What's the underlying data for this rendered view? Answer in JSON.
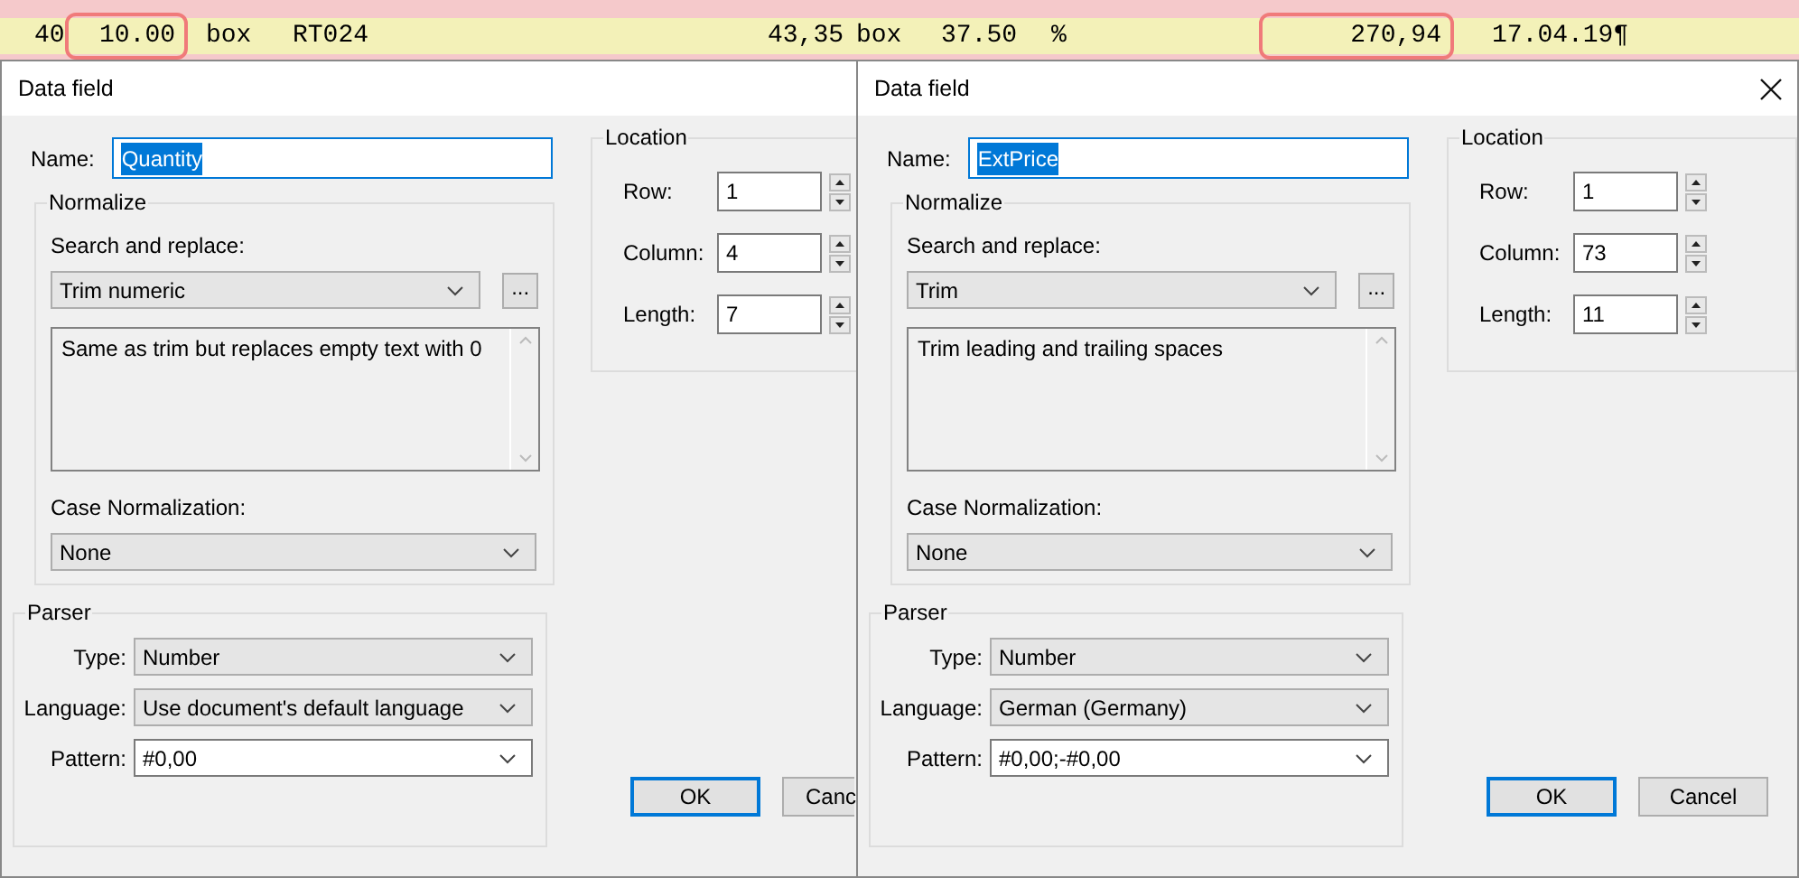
{
  "document_row": {
    "cells": [
      {
        "text": "40",
        "highlighted": false
      },
      {
        "text": "10.00",
        "highlighted": true
      },
      {
        "text": "box",
        "highlighted": false
      },
      {
        "text": "RT024",
        "highlighted": false
      },
      {
        "text": "43,35",
        "highlighted": false
      },
      {
        "text": "box",
        "highlighted": false
      },
      {
        "text": "37.50",
        "highlighted": false
      },
      {
        "text": "%",
        "highlighted": false
      },
      {
        "text": "270,94",
        "highlighted": true
      },
      {
        "text": "17.04.19¶",
        "highlighted": false
      }
    ]
  },
  "dialogs": [
    {
      "title": "Data field",
      "close_button": false,
      "name": {
        "label": "Name:",
        "value": "Quantity",
        "value_selected": true
      },
      "normalize": {
        "title": "Normalize",
        "search_label": "Search and replace:",
        "search_value": "Trim numeric",
        "more_button": "...",
        "description": "Same as trim but replaces empty text with 0",
        "case_label": "Case Normalization:",
        "case_value": "None"
      },
      "parser": {
        "title": "Parser",
        "fields": [
          {
            "kind": "combo",
            "label": "Type:",
            "value": "Number"
          },
          {
            "kind": "combo",
            "label": "Language:",
            "value": "Use document's default language"
          },
          {
            "kind": "editable",
            "label": "Pattern:",
            "value": "#0,00"
          }
        ]
      },
      "location": {
        "title": "Location",
        "fields": [
          {
            "label": "Row:",
            "value": "1"
          },
          {
            "label": "Column:",
            "value": "4"
          },
          {
            "label": "Length:",
            "value": "7"
          }
        ]
      },
      "buttons": [
        {
          "label": "OK",
          "default": true
        },
        {
          "label": "Canc",
          "default": false
        }
      ]
    },
    {
      "title": "Data field",
      "close_button": true,
      "name": {
        "label": "Name:",
        "value": "ExtPrice",
        "value_selected": true
      },
      "normalize": {
        "title": "Normalize",
        "search_label": "Search and replace:",
        "search_value": "Trim",
        "more_button": "...",
        "description": "Trim leading and trailing spaces",
        "case_label": "Case Normalization:",
        "case_value": "None"
      },
      "parser": {
        "title": "Parser",
        "fields": [
          {
            "kind": "combo",
            "label": "Type:",
            "value": "Number"
          },
          {
            "kind": "combo",
            "label": "Language:",
            "value": "German (Germany)"
          },
          {
            "kind": "editable",
            "label": "Pattern:",
            "value": "#0,00;-#0,00"
          }
        ]
      },
      "location": {
        "title": "Location",
        "fields": [
          {
            "label": "Row:",
            "value": "1"
          },
          {
            "label": "Column:",
            "value": "73"
          },
          {
            "label": "Length:",
            "value": "11"
          }
        ]
      },
      "buttons": [
        {
          "label": "OK",
          "default": true
        },
        {
          "label": "Cancel",
          "default": false
        }
      ]
    }
  ]
}
